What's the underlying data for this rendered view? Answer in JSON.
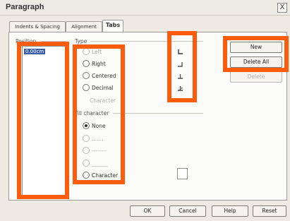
{
  "window": {
    "title": "Paragraph",
    "close_glyph": "X"
  },
  "tabs": [
    {
      "label": "Indents & Spacing",
      "active": false
    },
    {
      "label": "Alignment",
      "active": false
    },
    {
      "label": "Tabs",
      "active": true
    }
  ],
  "position": {
    "header": "Position",
    "value": "0.00cm"
  },
  "type": {
    "header": "Type",
    "options": [
      {
        "label": "Left",
        "selected": false
      },
      {
        "label": "Right",
        "selected": false
      },
      {
        "label": "Centered",
        "selected": false
      },
      {
        "label": "Decimal",
        "selected": false
      }
    ],
    "character_label": "Character"
  },
  "fill": {
    "header": "Fill character",
    "options": [
      {
        "label": "None",
        "selected": true
      },
      {
        "label": ".......",
        "selected": false
      },
      {
        "label": "--------",
        "selected": false
      },
      {
        "label": "______",
        "selected": false
      },
      {
        "label": "Character",
        "selected": false
      }
    ]
  },
  "side_buttons": {
    "new": "New",
    "delete_all": "Delete All",
    "delete": "Delete"
  },
  "footer": {
    "ok": "OK",
    "cancel": "Cancel",
    "help": "Help",
    "reset": "Reset"
  },
  "colors": {
    "highlight": "#fc5c0c",
    "selection": "#3b5fa6"
  },
  "icons": [
    "tab-left-icon",
    "tab-right-icon",
    "tab-center-icon",
    "tab-decimal-icon"
  ]
}
